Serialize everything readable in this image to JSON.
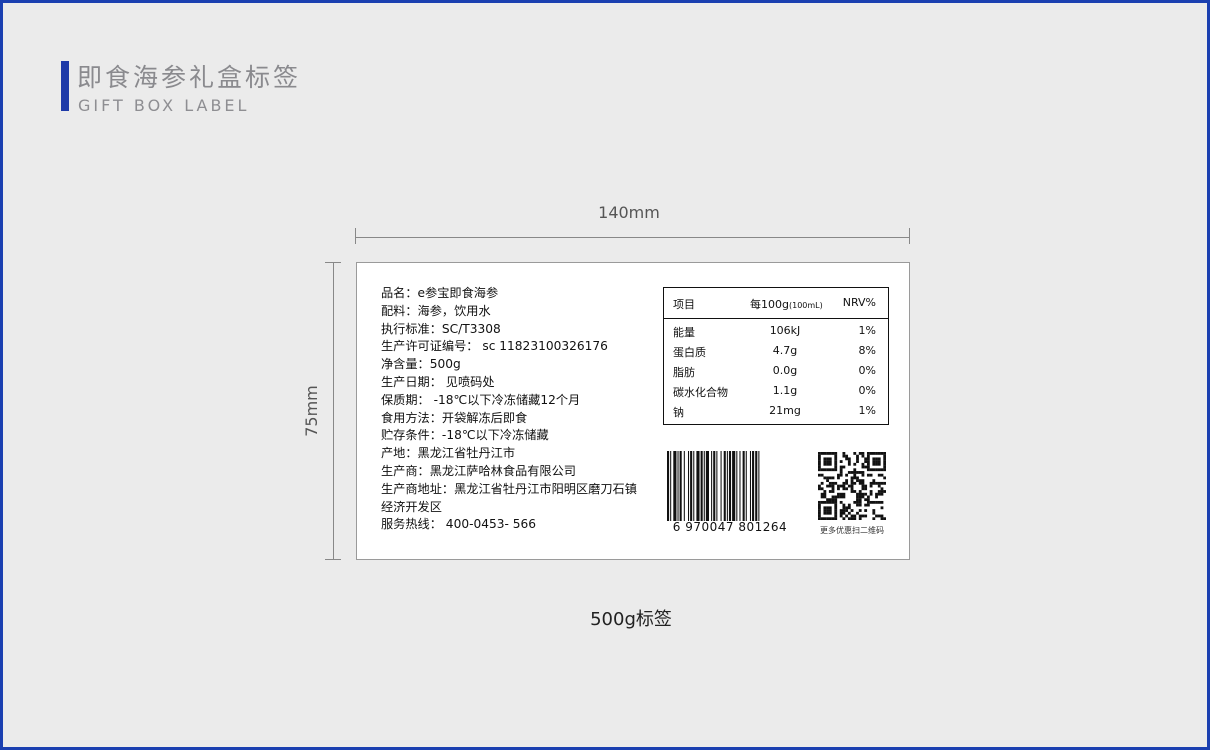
{
  "header": {
    "title_cn": "即食海参礼盒标签",
    "title_en": "GIFT BOX LABEL"
  },
  "dimensions": {
    "width_label": "140mm",
    "height_label": "75mm"
  },
  "label": {
    "info_lines": [
      "品名：e参宝即食海参",
      "配料：海参，饮用水",
      "执行标准：SC/T3308",
      "生产许可证编号： sc 11823100326176",
      "净含量：500g",
      "生产日期： 见喷码处",
      "保质期： -18℃以下冷冻储藏12个月",
      "食用方法：开袋解冻后即食",
      "贮存条件：-18℃以下冷冻储藏",
      "产地：黑龙江省牡丹江市",
      "生产商：黑龙江萨哈林食品有限公司",
      "生产商地址：黑龙江省牡丹江市阳明区磨刀石镇经济开发区",
      "服务热线： 400-0453- 566"
    ],
    "nutrition": {
      "header": {
        "item": "项目",
        "per": "每100g",
        "per_unit": "(100mL)",
        "nrv": "NRV%"
      },
      "rows": [
        {
          "name": "能量",
          "value": "106kJ",
          "nrv": "1%"
        },
        {
          "name": "蛋白质",
          "value": "4.7g",
          "nrv": "8%"
        },
        {
          "name": "脂肪",
          "value": "0.0g",
          "nrv": "0%"
        },
        {
          "name": "碳水化合物",
          "value": "1.1g",
          "nrv": "0%"
        },
        {
          "name": "钠",
          "value": "21mg",
          "nrv": "1%"
        }
      ]
    },
    "barcode_number": "6 970047 801264",
    "qr_caption": "更多优惠扫二维码"
  },
  "caption": "500g标签",
  "colors": {
    "accent": "#1e3aa8",
    "frame_border": "#1a3fb0",
    "background": "#ebebeb"
  }
}
